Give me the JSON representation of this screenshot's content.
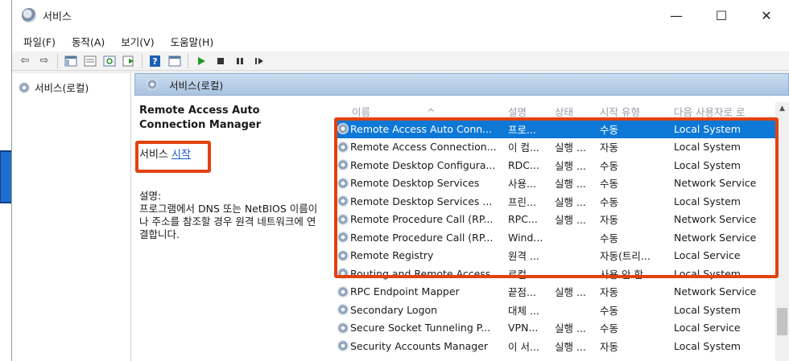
{
  "window": {
    "title": "서비스",
    "minimize": "—",
    "maximize": "☐",
    "close": "✕"
  },
  "menu": [
    "파일(F)",
    "동작(A)",
    "보기(V)",
    "도움말(H)"
  ],
  "toolbar": {
    "icons": [
      "back-arrow-icon",
      "forward-arrow-icon",
      "console-tree-icon",
      "properties-icon",
      "refresh-icon",
      "export-icon",
      "help-icon",
      "view-icon",
      "play-icon",
      "stop-icon",
      "pause-icon",
      "resume-icon"
    ]
  },
  "tree": {
    "root": "서비스(로컬)"
  },
  "main_header": "서비스(로컬)",
  "details": {
    "title": "Remote Access Auto Connection Manager",
    "action_prefix": "서비스",
    "action_link": "시작",
    "desc_label": "설명:",
    "desc_text": "프로그램에서 DNS 또는 NetBIOS 이름이나 주소를 참조할 경우 원격 네트워크에 연결합니다."
  },
  "columns": {
    "name": "이름",
    "desc": "설명",
    "status": "상태",
    "start": "시작 유형",
    "logon": "다음 사용자로 로"
  },
  "rows": [
    {
      "name": "Remote Access Auto Conn...",
      "desc": "프로...",
      "status": "",
      "start": "수동",
      "logon": "Local System"
    },
    {
      "name": "Remote Access Connection...",
      "desc": "이 컴...",
      "status": "실행 ...",
      "start": "자동",
      "logon": "Local System"
    },
    {
      "name": "Remote Desktop Configura...",
      "desc": "RDC...",
      "status": "실행 ...",
      "start": "수동",
      "logon": "Local System"
    },
    {
      "name": "Remote Desktop Services",
      "desc": "사용...",
      "status": "실행 ...",
      "start": "수동",
      "logon": "Network Service"
    },
    {
      "name": "Remote Desktop Services ...",
      "desc": "프린...",
      "status": "실행 ...",
      "start": "수동",
      "logon": "Local System"
    },
    {
      "name": "Remote Procedure Call (RP...",
      "desc": "RPC...",
      "status": "실행 ...",
      "start": "자동",
      "logon": "Network Service"
    },
    {
      "name": "Remote Procedure Call (RP...",
      "desc": "Wind...",
      "status": "",
      "start": "수동",
      "logon": "Network Service"
    },
    {
      "name": "Remote Registry",
      "desc": "원격 ...",
      "status": "",
      "start": "자동(트리...",
      "logon": "Local Service"
    },
    {
      "name": "Routing and Remote Access",
      "desc": "로컬 ...",
      "status": "",
      "start": "사용 안 함",
      "logon": "Local System"
    },
    {
      "name": "RPC Endpoint Mapper",
      "desc": "끝점...",
      "status": "실행 ...",
      "start": "자동",
      "logon": "Network Service"
    },
    {
      "name": "Secondary Logon",
      "desc": "대체 ...",
      "status": "",
      "start": "수동",
      "logon": "Local System"
    },
    {
      "name": "Secure Socket Tunneling P...",
      "desc": "VPN...",
      "status": "실행 ...",
      "start": "수동",
      "logon": "Local Service"
    },
    {
      "name": "Security Accounts Manager",
      "desc": "이 서...",
      "status": "실행 ...",
      "start": "자동",
      "logon": "Local System"
    }
  ],
  "colors": {
    "selection": "#0e78d7",
    "highlight_border": "#e2420f",
    "arrow": "#1e6fd0"
  }
}
